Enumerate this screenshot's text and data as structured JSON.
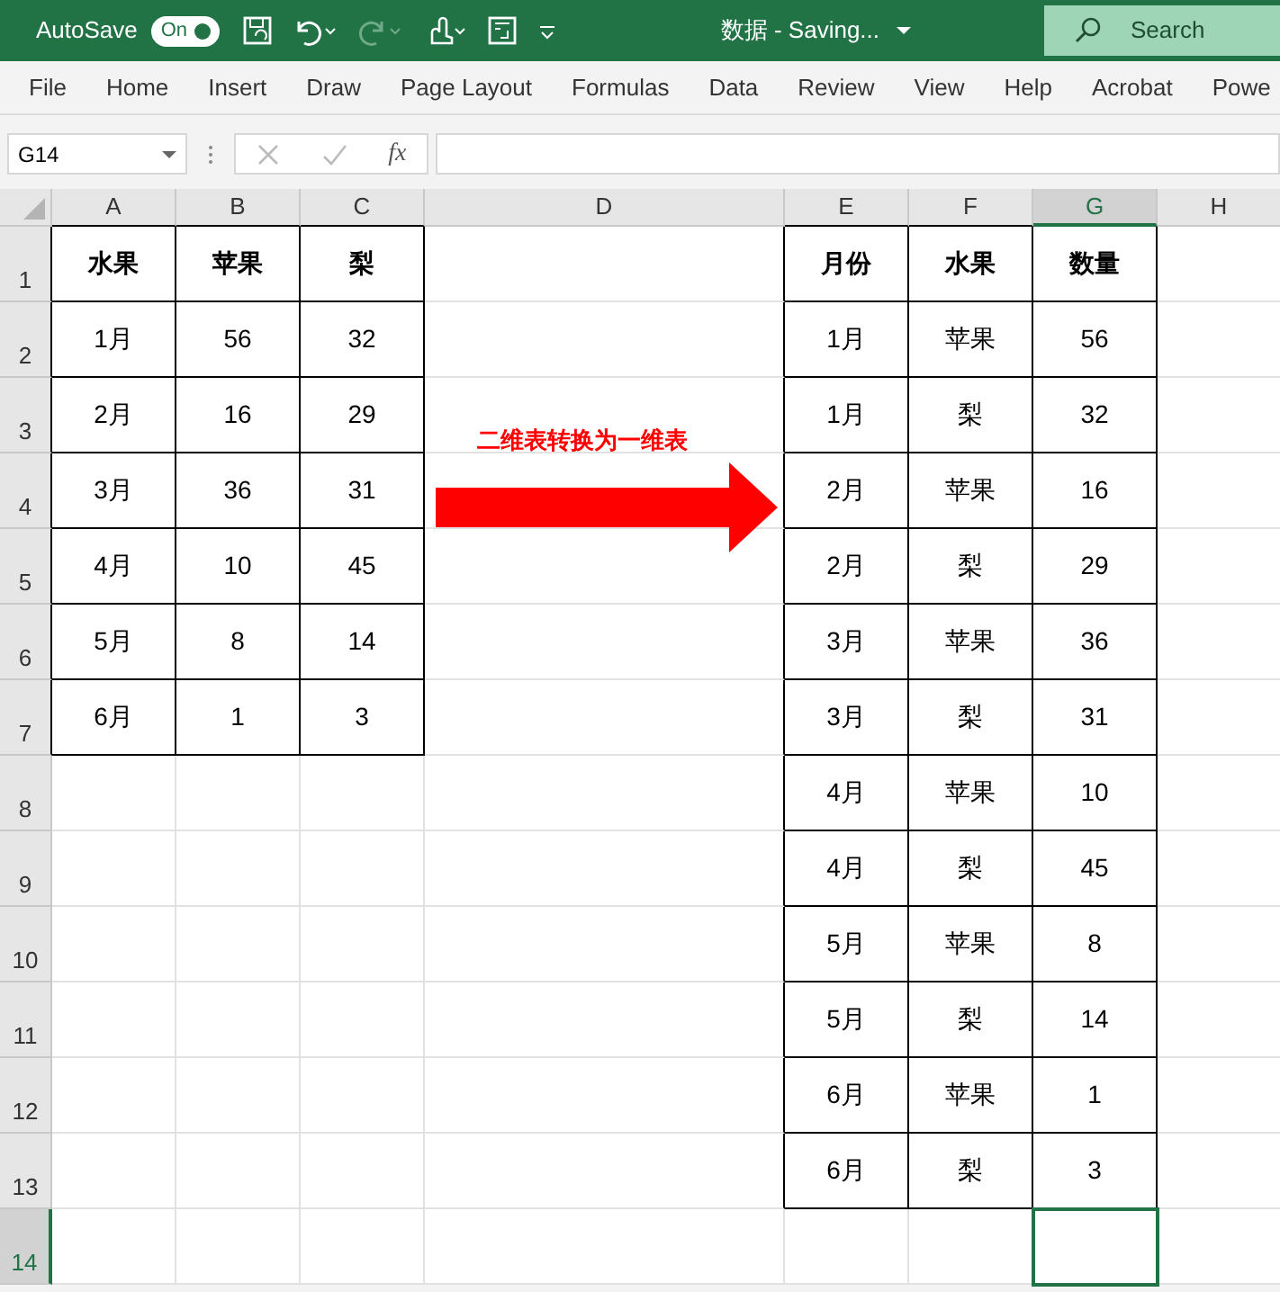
{
  "title_bar": {
    "autosave_label": "AutoSave",
    "autosave_toggle": {
      "label": "On",
      "on": true
    },
    "title": "数据  -  Saving...",
    "search": {
      "placeholder": "Search"
    }
  },
  "ribbon_tabs": [
    {
      "label": "File"
    },
    {
      "label": "Home"
    },
    {
      "label": "Insert"
    },
    {
      "label": "Draw"
    },
    {
      "label": "Page Layout"
    },
    {
      "label": "Formulas"
    },
    {
      "label": "Data"
    },
    {
      "label": "Review"
    },
    {
      "label": "View"
    },
    {
      "label": "Help"
    },
    {
      "label": "Acrobat"
    },
    {
      "label": "Powe"
    }
  ],
  "formula_bar": {
    "name_box": "G14",
    "fx": "fx"
  },
  "sheet": {
    "columns": [
      {
        "label": "A",
        "selected": false
      },
      {
        "label": "B",
        "selected": false
      },
      {
        "label": "C",
        "selected": false
      },
      {
        "label": "D",
        "selected": false
      },
      {
        "label": "E",
        "selected": false
      },
      {
        "label": "F",
        "selected": false
      },
      {
        "label": "G",
        "selected": true
      },
      {
        "label": "H",
        "selected": false
      }
    ],
    "rows": [
      {
        "label": "1",
        "selected": false,
        "kind": "header",
        "cells": {
          "A": "水果",
          "B": "苹果",
          "C": "梨",
          "E": "月份",
          "F": "水果",
          "G": "数量"
        }
      },
      {
        "label": "2",
        "selected": false,
        "kind": "data",
        "cells": {
          "A": "1月",
          "B": "56",
          "C": "32",
          "E": "1月",
          "F": "苹果",
          "G": "56"
        }
      },
      {
        "label": "3",
        "selected": false,
        "kind": "data",
        "cells": {
          "A": "2月",
          "B": "16",
          "C": "29",
          "E": "1月",
          "F": "梨",
          "G": "32"
        }
      },
      {
        "label": "4",
        "selected": false,
        "kind": "data",
        "cells": {
          "A": "3月",
          "B": "36",
          "C": "31",
          "E": "2月",
          "F": "苹果",
          "G": "16"
        }
      },
      {
        "label": "5",
        "selected": false,
        "kind": "data",
        "cells": {
          "A": "4月",
          "B": "10",
          "C": "45",
          "E": "2月",
          "F": "梨",
          "G": "29"
        }
      },
      {
        "label": "6",
        "selected": false,
        "kind": "data",
        "cells": {
          "A": "5月",
          "B": "8",
          "C": "14",
          "E": "3月",
          "F": "苹果",
          "G": "36"
        }
      },
      {
        "label": "7",
        "selected": false,
        "kind": "data",
        "cells": {
          "A": "6月",
          "B": "1",
          "C": "3",
          "E": "3月",
          "F": "梨",
          "G": "31"
        }
      },
      {
        "label": "8",
        "selected": false,
        "kind": "data",
        "cells": {
          "E": "4月",
          "F": "苹果",
          "G": "10"
        }
      },
      {
        "label": "9",
        "selected": false,
        "kind": "data",
        "cells": {
          "E": "4月",
          "F": "梨",
          "G": "45"
        }
      },
      {
        "label": "10",
        "selected": false,
        "kind": "data",
        "cells": {
          "E": "5月",
          "F": "苹果",
          "G": "8"
        }
      },
      {
        "label": "11",
        "selected": false,
        "kind": "data",
        "cells": {
          "E": "5月",
          "F": "梨",
          "G": "14"
        }
      },
      {
        "label": "12",
        "selected": false,
        "kind": "data",
        "cells": {
          "E": "6月",
          "F": "苹果",
          "G": "1"
        }
      },
      {
        "label": "13",
        "selected": false,
        "kind": "data",
        "cells": {
          "E": "6月",
          "F": "梨",
          "G": "3"
        }
      },
      {
        "label": "14",
        "selected": true,
        "kind": "data",
        "cells": {}
      }
    ],
    "annotation": {
      "text": "二维表转换为一维表",
      "color": "#ff0000"
    }
  }
}
